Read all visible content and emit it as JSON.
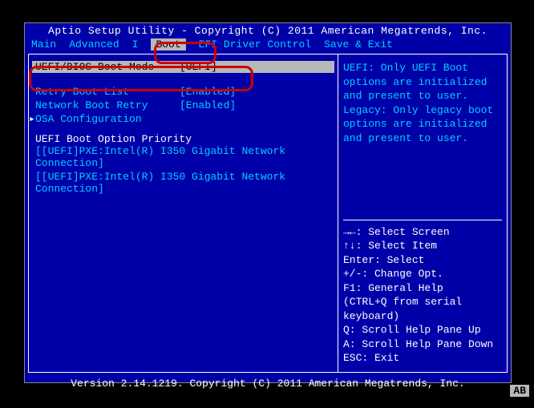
{
  "header": {
    "title": "Aptio Setup Utility - Copyright (C) 2011 American Megatrends, Inc."
  },
  "menu": {
    "items": [
      "Main",
      "Advanced",
      "I",
      "Boot",
      "EFI Driver Control",
      "Save & Exit"
    ],
    "active": "Boot"
  },
  "boot_mode": {
    "label": "UEFI/BIOS Boot Mode",
    "value": "[UEFI]"
  },
  "options": [
    {
      "label": "Retry Boot List",
      "value": "[Enabled]"
    },
    {
      "label": "Network Boot Retry",
      "value": "[Enabled]"
    },
    {
      "label": "OSA Configuration",
      "value": ""
    }
  ],
  "priority": {
    "heading": "UEFI Boot Option Priority",
    "entries": [
      "[[UEFI]PXE:Intel(R) I350 Gigabit Network Connection]",
      "[[UEFI]PXE:Intel(R) I350 Gigabit Network Connection]"
    ]
  },
  "help_text": "UEFI: Only UEFI Boot options are initialized and present to user. Legacy: Only legacy boot options are initialized and present to user.",
  "key_help": {
    "l1": "→←: Select Screen",
    "l2": "↑↓: Select Item",
    "l3": "Enter: Select",
    "l4": "+/-: Change Opt.",
    "l5": "F1: General Help",
    "l6": " (CTRL+Q from serial",
    "l7": " keyboard)",
    "l8": "Q: Scroll Help Pane Up",
    "l9": "A: Scroll Help Pane Down",
    "l10": "ESC: Exit"
  },
  "footer": {
    "version": "Version 2.14.1219. Copyright (C) 2011 American Megatrends, Inc."
  },
  "corner": "AB"
}
